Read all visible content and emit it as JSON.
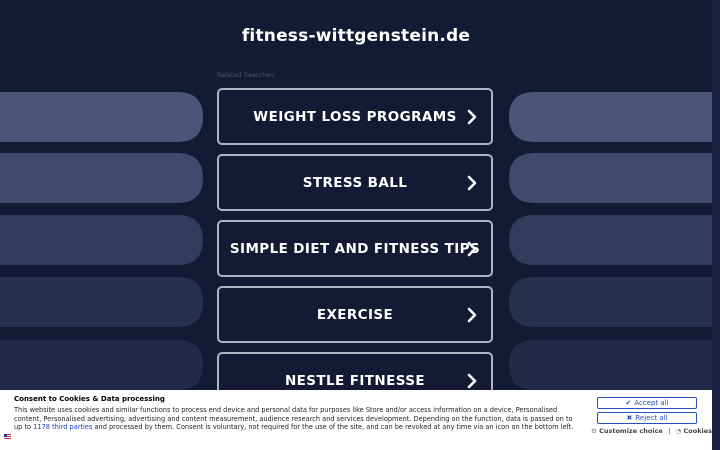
{
  "site": {
    "title": "fitness-wittgenstein.de"
  },
  "related": {
    "label": "Related Searches:"
  },
  "searches": [
    {
      "label": "WEIGHT LOSS PROGRAMS"
    },
    {
      "label": "STRESS BALL"
    },
    {
      "label": "SIMPLE DIET AND FITNESS TIPS"
    },
    {
      "label": "EXERCISE"
    },
    {
      "label": "NESTLE FITNESSE"
    }
  ],
  "consent": {
    "title": "Consent to Cookies & Data processing",
    "text_before_link": "This website uses cookies and similar functions to process end device and personal data for purposes like Store and/or access information on a device, Personalised content, Personalised advertising, advertising and content measurement, audience research and services development. Depending on the function, data is passed on to up to ",
    "link_text": "1178 third parties",
    "text_after_link": " and processed by them. Consent is voluntary, not required for the use of the site, and can be revoked at any time via an icon on the bottom left.",
    "accept_label": "Accept all",
    "reject_label": "Reject all",
    "customize_label": "Customize choice",
    "separator": "|",
    "cookies_label": "Cookies"
  },
  "colors": {
    "background": "#131a33",
    "shape_top": "#4a5578",
    "shape_bottom": "#1e2645",
    "accent": "#2a4fbf"
  }
}
